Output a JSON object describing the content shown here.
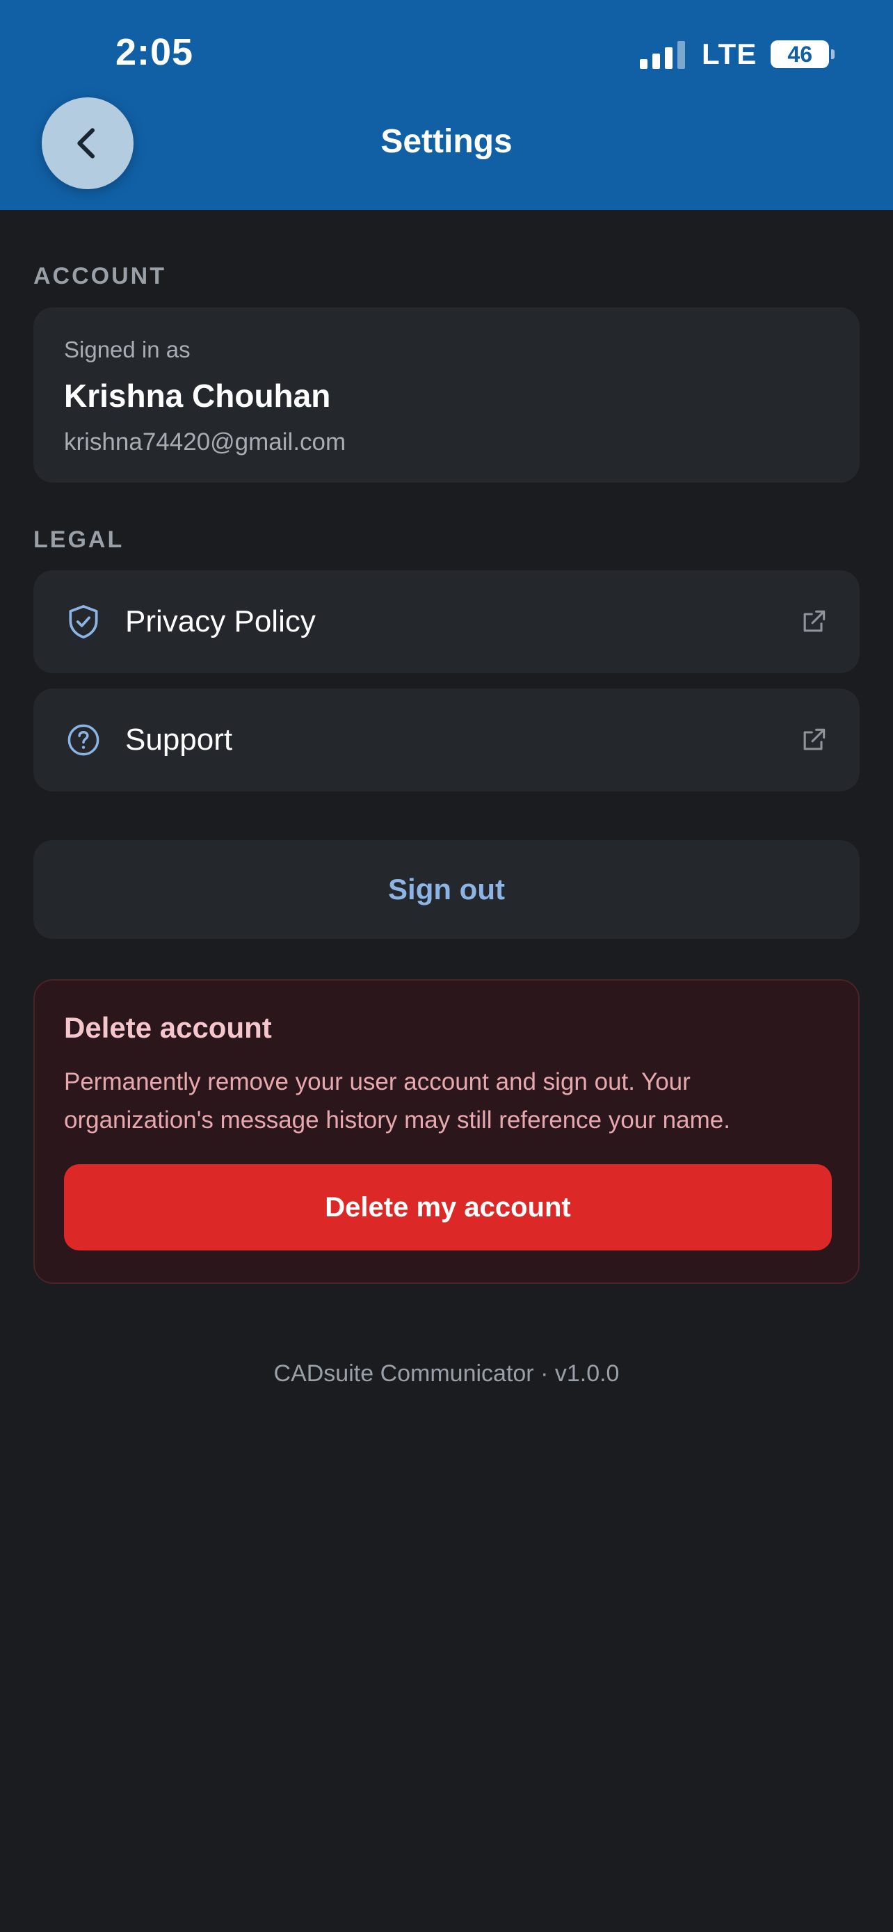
{
  "status_bar": {
    "time": "2:05",
    "network": "LTE",
    "battery": "46"
  },
  "header": {
    "title": "Settings",
    "back_icon": "chevron-left-icon"
  },
  "account": {
    "section_label": "ACCOUNT",
    "signed_in_label": "Signed in as",
    "name": "Krishna Chouhan",
    "email": "krishna74420@gmail.com"
  },
  "legal": {
    "section_label": "LEGAL",
    "items": [
      {
        "label": "Privacy Policy",
        "icon": "shield-check-icon",
        "trailing_icon": "external-link-icon"
      },
      {
        "label": "Support",
        "icon": "help-circle-icon",
        "trailing_icon": "external-link-icon"
      }
    ]
  },
  "sign_out": {
    "label": "Sign out"
  },
  "delete_account": {
    "title": "Delete account",
    "description": "Permanently remove your user account and sign out. Your organization's message history may still reference your name.",
    "button_label": "Delete my account"
  },
  "footer": {
    "text": "CADsuite Communicator · v1.0.0"
  },
  "colors": {
    "header_bg": "#1160a6",
    "page_bg": "#1b1c20",
    "card_bg": "#24272c",
    "accent_link": "#8cb4e4",
    "danger_bg": "#2b171b",
    "danger_button": "#dc2826"
  }
}
